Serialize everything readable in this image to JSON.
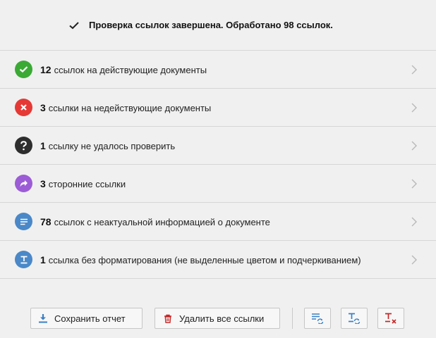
{
  "header": {
    "title": "Проверка ссылок завершена. Обработано 98 ссылок."
  },
  "rows": [
    {
      "count": "12",
      "text": "ссылок на действующие документы",
      "icon": "check-circle-icon",
      "color": "#3aaa35"
    },
    {
      "count": "3",
      "text": "ссылки на недействующие документы",
      "icon": "x-circle-icon",
      "color": "#e53935"
    },
    {
      "count": "1",
      "text": "ссылку не удалось проверить",
      "icon": "question-circle-icon",
      "color": "#2d2d2d"
    },
    {
      "count": "3",
      "text": "сторонние ссылки",
      "icon": "share-arrow-icon",
      "color": "#9c5cd6"
    },
    {
      "count": "78",
      "text": "ссылок с неактуальной информацией о документе",
      "icon": "document-lines-icon",
      "color": "#4a88c8"
    },
    {
      "count": "1",
      "text": "ссылка без форматирования (не выделенные цветом и подчеркиванием)",
      "icon": "text-format-icon",
      "color": "#4a88c8"
    }
  ],
  "footer": {
    "save_label": "Сохранить отчет",
    "delete_label": "Удалить все ссылки"
  },
  "colors": {
    "background": "#f0f0f0",
    "icon_blue": "#3b7fc4",
    "icon_red": "#c62828"
  }
}
